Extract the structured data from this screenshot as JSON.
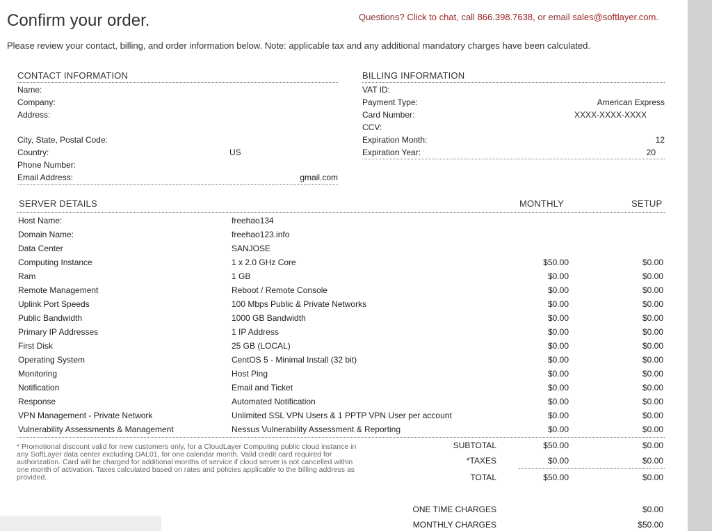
{
  "header": {
    "title": "Confirm your order.",
    "questions_prefix": "Questions?",
    "chat_link": "Click to chat,",
    "call_text": "call",
    "phone": "866.398.7638,",
    "email_text": "or email",
    "email": "sales@softlayer.com."
  },
  "intro": "Please review your contact, billing, and order information below. Note: applicable tax and any additional mandatory charges have been calculated.",
  "contact": {
    "heading": "CONTACT INFORMATION",
    "rows": [
      {
        "label": "Name:",
        "value": ""
      },
      {
        "label": "Company:",
        "value": ""
      },
      {
        "label": "Address:",
        "value": ""
      },
      {
        "label": "City, State, Postal Code:",
        "value": ""
      },
      {
        "label": "Country:",
        "value": "US"
      },
      {
        "label": "Phone Number:",
        "value": ""
      },
      {
        "label": "Email Address:",
        "value": "gmail.com"
      }
    ]
  },
  "billing": {
    "heading": "BILLING INFORMATION",
    "rows": [
      {
        "label": "VAT ID:",
        "value": ""
      },
      {
        "label": "Payment Type:",
        "value": "American Express"
      },
      {
        "label": "Card Number:",
        "value": "XXXX-XXXX-XXXX"
      },
      {
        "label": "CCV:",
        "value": ""
      },
      {
        "label": "Expiration Month:",
        "value": "12"
      },
      {
        "label": "Expiration Year:",
        "value": "20"
      }
    ]
  },
  "server": {
    "heading": "SERVER DETAILS",
    "col_monthly": "MONTHLY",
    "col_setup": "SETUP",
    "rows": [
      {
        "name": "Host Name:",
        "desc": "freehao134",
        "monthly": "",
        "setup": ""
      },
      {
        "name": "Domain Name:",
        "desc": "freehao123.info",
        "monthly": "",
        "setup": ""
      },
      {
        "name": "Data Center",
        "desc": "SANJOSE",
        "monthly": "",
        "setup": ""
      },
      {
        "name": "Computing Instance",
        "desc": "1 x 2.0 GHz Core",
        "monthly": "$50.00",
        "setup": "$0.00"
      },
      {
        "name": "Ram",
        "desc": "1 GB",
        "monthly": "$0.00",
        "setup": "$0.00"
      },
      {
        "name": "Remote Management",
        "desc": "Reboot / Remote Console",
        "monthly": "$0.00",
        "setup": "$0.00"
      },
      {
        "name": "Uplink Port Speeds",
        "desc": "100 Mbps Public & Private Networks",
        "monthly": "$0.00",
        "setup": "$0.00"
      },
      {
        "name": "Public Bandwidth",
        "desc": "1000 GB Bandwidth",
        "monthly": "$0.00",
        "setup": "$0.00"
      },
      {
        "name": "Primary IP Addresses",
        "desc": "1 IP Address",
        "monthly": "$0.00",
        "setup": "$0.00"
      },
      {
        "name": "First Disk",
        "desc": "25 GB (LOCAL)",
        "monthly": "$0.00",
        "setup": "$0.00"
      },
      {
        "name": "Operating System",
        "desc": "CentOS 5 - Minimal Install (32 bit)",
        "monthly": "$0.00",
        "setup": "$0.00"
      },
      {
        "name": "Monitoring",
        "desc": "Host Ping",
        "monthly": "$0.00",
        "setup": "$0.00"
      },
      {
        "name": "Notification",
        "desc": "Email and Ticket",
        "monthly": "$0.00",
        "setup": "$0.00"
      },
      {
        "name": "Response",
        "desc": "Automated Notification",
        "monthly": "$0.00",
        "setup": "$0.00"
      },
      {
        "name": "VPN Management - Private Network",
        "desc": "Unlimited SSL VPN Users & 1 PPTP VPN User per account",
        "monthly": "$0.00",
        "setup": "$0.00"
      },
      {
        "name": "Vulnerability Assessments & Management",
        "desc": "Nessus Vulnerability Assessment & Reporting",
        "monthly": "$0.00",
        "setup": "$0.00"
      }
    ]
  },
  "promo": "* Promotional discount valid for new customers only, for a CloudLayer Computing public cloud instance in any SoftLayer data center excluding DAL01, for one calendar month. Valid credit card required for authorization. Card will be charged for additional months of service if cloud server is not cancelled within one month of activation. Taxes calculated based on rates and policies applicable to the billing address as provided.",
  "totals": {
    "subtotal_label": "SUBTOTAL",
    "subtotal_monthly": "$50.00",
    "subtotal_setup": "$0.00",
    "taxes_label": "*TAXES",
    "taxes_monthly": "$0.00",
    "taxes_setup": "$0.00",
    "total_label": "TOTAL",
    "total_monthly": "$50.00",
    "total_setup": "$0.00"
  },
  "charges": {
    "one_time_label": "ONE TIME CHARGES",
    "one_time_value": "$0.00",
    "monthly_label": "MONTHLY CHARGES",
    "monthly_value": "$50.00"
  }
}
